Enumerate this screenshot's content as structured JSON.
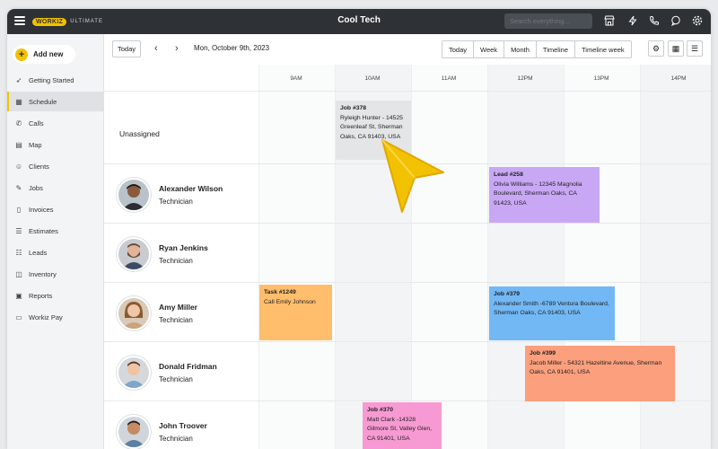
{
  "app": {
    "logo_text": "WORKIZ",
    "tier": "ULTIMATE",
    "title": "Cool Tech",
    "search_placeholder": "Search everything...",
    "brand_color": "#f2c200",
    "topbar_color": "#2e3236"
  },
  "topbar_icons": [
    "store-icon",
    "bolt-icon",
    "phone-icon",
    "chat-icon",
    "gear-icon"
  ],
  "sidebar": {
    "add_new": "Add new",
    "items": [
      {
        "label": "Getting Started",
        "icon": "rocket-icon"
      },
      {
        "label": "Schedule",
        "icon": "calendar-icon",
        "active": true
      },
      {
        "label": "Calls",
        "icon": "phone-icon"
      },
      {
        "label": "Map",
        "icon": "map-icon"
      },
      {
        "label": "Clients",
        "icon": "clients-icon"
      },
      {
        "label": "Jobs",
        "icon": "wrench-icon"
      },
      {
        "label": "Invoices",
        "icon": "invoice-icon"
      },
      {
        "label": "Estimates",
        "icon": "estimate-icon"
      },
      {
        "label": "Leads",
        "icon": "leads-icon"
      },
      {
        "label": "Inventory",
        "icon": "box-icon"
      },
      {
        "label": "Reports",
        "icon": "report-icon"
      },
      {
        "label": "Workiz Pay",
        "icon": "card-icon"
      }
    ]
  },
  "toolbar": {
    "today": "Today",
    "date": "Mon, October 9th, 2023",
    "views": [
      "Today",
      "Week",
      "Month",
      "Timeline",
      "Timeline week"
    ]
  },
  "schedule": {
    "times": [
      "9AM",
      "10AM",
      "11AM",
      "12PM",
      "13PM",
      "14PM"
    ],
    "unassigned": "Unassigned",
    "technicians": [
      {
        "name": "Alexander Wilson",
        "role": "Technician"
      },
      {
        "name": "Ryan Jenkins",
        "role": "Technician"
      },
      {
        "name": "Amy Miller",
        "role": "Technician"
      },
      {
        "name": "Donald Fridman",
        "role": "Technician"
      },
      {
        "name": "John Troover",
        "role": "Technician"
      }
    ],
    "jobs": [
      {
        "title": "Job #378",
        "text": "Ryleigh Hunter - 14525 Greenleaf St, Sherman Oaks,  CA 91403, USA",
        "color": "#e3e5e7"
      },
      {
        "title": "Lead #258",
        "text": "Olivia Williams - 12345 Magnolia Boulevard, Sherman Oaks, CA 91423, USA",
        "color": "#c8a8f5"
      },
      {
        "title": "Task #1249",
        "text": "Call Emily Johnson",
        "color": "#ffbe6b"
      },
      {
        "title": "Job #379",
        "text": "Alexander Smith -6789 Ventura Boulevard, Sherman Oaks, CA 91403, USA",
        "color": "#72b8f5"
      },
      {
        "title": "Job #399",
        "text": "Jacob Miller - 54321 Hazeltine Avenue, Sherman Oaks, CA 91401, USA",
        "color": "#fb9f7c"
      },
      {
        "title": "Job #370",
        "text": "Matt Clark -14328 Gilmore St, Valley Glen, CA 91401, USA",
        "color": "#f79ad3"
      }
    ]
  }
}
